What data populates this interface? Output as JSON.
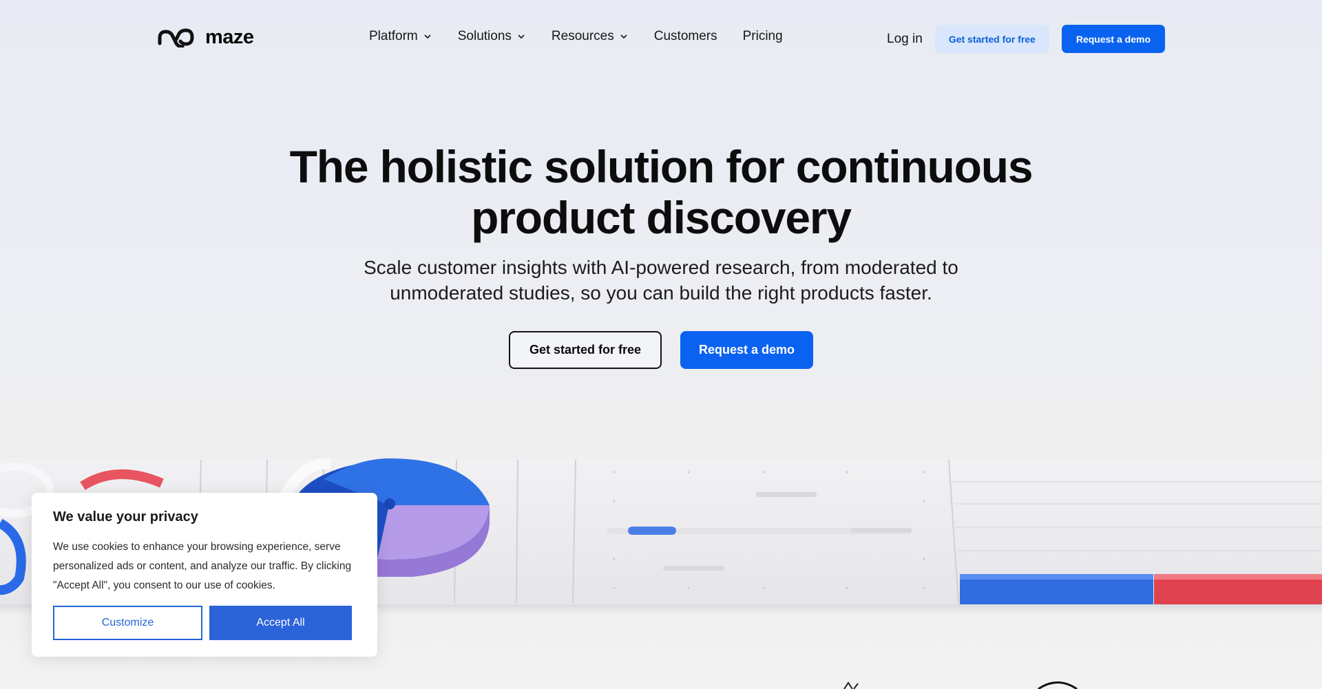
{
  "nav": {
    "logo_text": "maze",
    "links": [
      {
        "label": "Platform",
        "dropdown": true
      },
      {
        "label": "Solutions",
        "dropdown": true
      },
      {
        "label": "Resources",
        "dropdown": true
      },
      {
        "label": "Customers",
        "dropdown": false
      },
      {
        "label": "Pricing",
        "dropdown": false
      }
    ],
    "login_label": "Log in",
    "get_started_label": "Get started for free",
    "request_demo_label": "Request a demo"
  },
  "hero": {
    "title_line1": "The holistic solution for continuous",
    "title_line2": "product discovery",
    "subtitle_line1": "Scale customer insights with AI-powered research, from moderated to",
    "subtitle_line2": "unmoderated studies, so you can build the right products faster.",
    "cta_primary": "Get started for free",
    "cta_secondary": "Request a demo"
  },
  "cookie_banner": {
    "title": "We value your privacy",
    "text": "We use cookies to enhance your browsing experience, serve personalized ads or content, and analyze our traffic. By clicking \"Accept All\", you consent to our use of cookies.",
    "customize_label": "Customize",
    "accept_label": "Accept All"
  },
  "colors": {
    "brand_blue": "#0a63f0",
    "light_blue_button": "#d9e6fb",
    "cookie_blue": "#2b63d9",
    "illustration_purple": "#b59be8",
    "illustration_red": "#e8545f"
  },
  "icons": {
    "logo": "maze-logo-icon",
    "dropdown": "chevron-down-icon"
  }
}
